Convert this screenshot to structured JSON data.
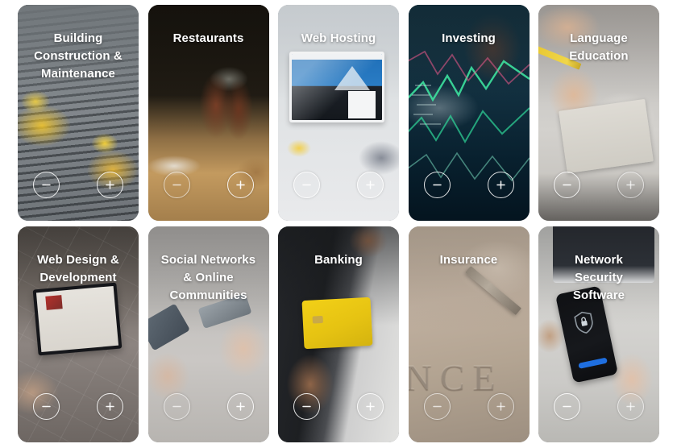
{
  "page": {
    "background_color": "#ffffff",
    "grid_columns": 5,
    "grid_rows": 2
  },
  "controls": {
    "decrease_label": "minus-button",
    "increase_label": "plus-button"
  },
  "cards": [
    {
      "id": "building-construction-maintenance",
      "title": "Building Construction & Maintenance",
      "title_lines": [
        "Building",
        "Construction &",
        "Maintenance"
      ],
      "image_subject": "two workers in hi-vis vests and yellow hard hats on a grey corrugated roof"
    },
    {
      "id": "restaurants",
      "title": "Restaurants",
      "title_lines": [
        "Restaurants"
      ],
      "image_subject": "dark restaurant table setting with wooden pepper mills and napkin"
    },
    {
      "id": "web-hosting",
      "title": "Web Hosting",
      "title_lines": [
        "Web Hosting"
      ],
      "image_subject": "desktop monitor on a bright desk showing a blue website, yellow mug beside it"
    },
    {
      "id": "investing",
      "title": "Investing",
      "title_lines": [
        "Investing"
      ],
      "image_subject": "dark teal screen with neon green and pink stock market candlestick lines"
    },
    {
      "id": "language-education",
      "title": "Language Education",
      "title_lines": [
        "Language",
        "Education"
      ],
      "image_subject": "hand with a yellow pencil writing in an open notebook"
    },
    {
      "id": "web-design-development",
      "title": "Web Design & Development",
      "title_lines": [
        "Web Design &",
        "Development"
      ],
      "image_subject": "hands typing on a laptop placed on a tiled floor"
    },
    {
      "id": "social-networks-online-communities",
      "title": "Social Networks & Online Communities",
      "title_lines": [
        "Social Networks",
        "& Online",
        "Communities"
      ],
      "image_subject": "two hands holding smartphones facing each other"
    },
    {
      "id": "banking",
      "title": "Banking",
      "title_lines": [
        "Banking"
      ],
      "image_subject": "hand holding a yellow bank card in front of a dark jacket"
    },
    {
      "id": "insurance",
      "title": "Insurance",
      "title_lines": [
        "Insurance"
      ],
      "image_subject": "pen nib resting on embossed beige paper reading INSURANCE",
      "embossed_text": "NCE"
    },
    {
      "id": "network-security-software",
      "title": "Network Security Software",
      "title_lines": [
        "Network",
        "Security",
        "Software"
      ],
      "image_subject": "hand holding a black smartphone displaying a shield with padlock, laptop behind"
    }
  ]
}
